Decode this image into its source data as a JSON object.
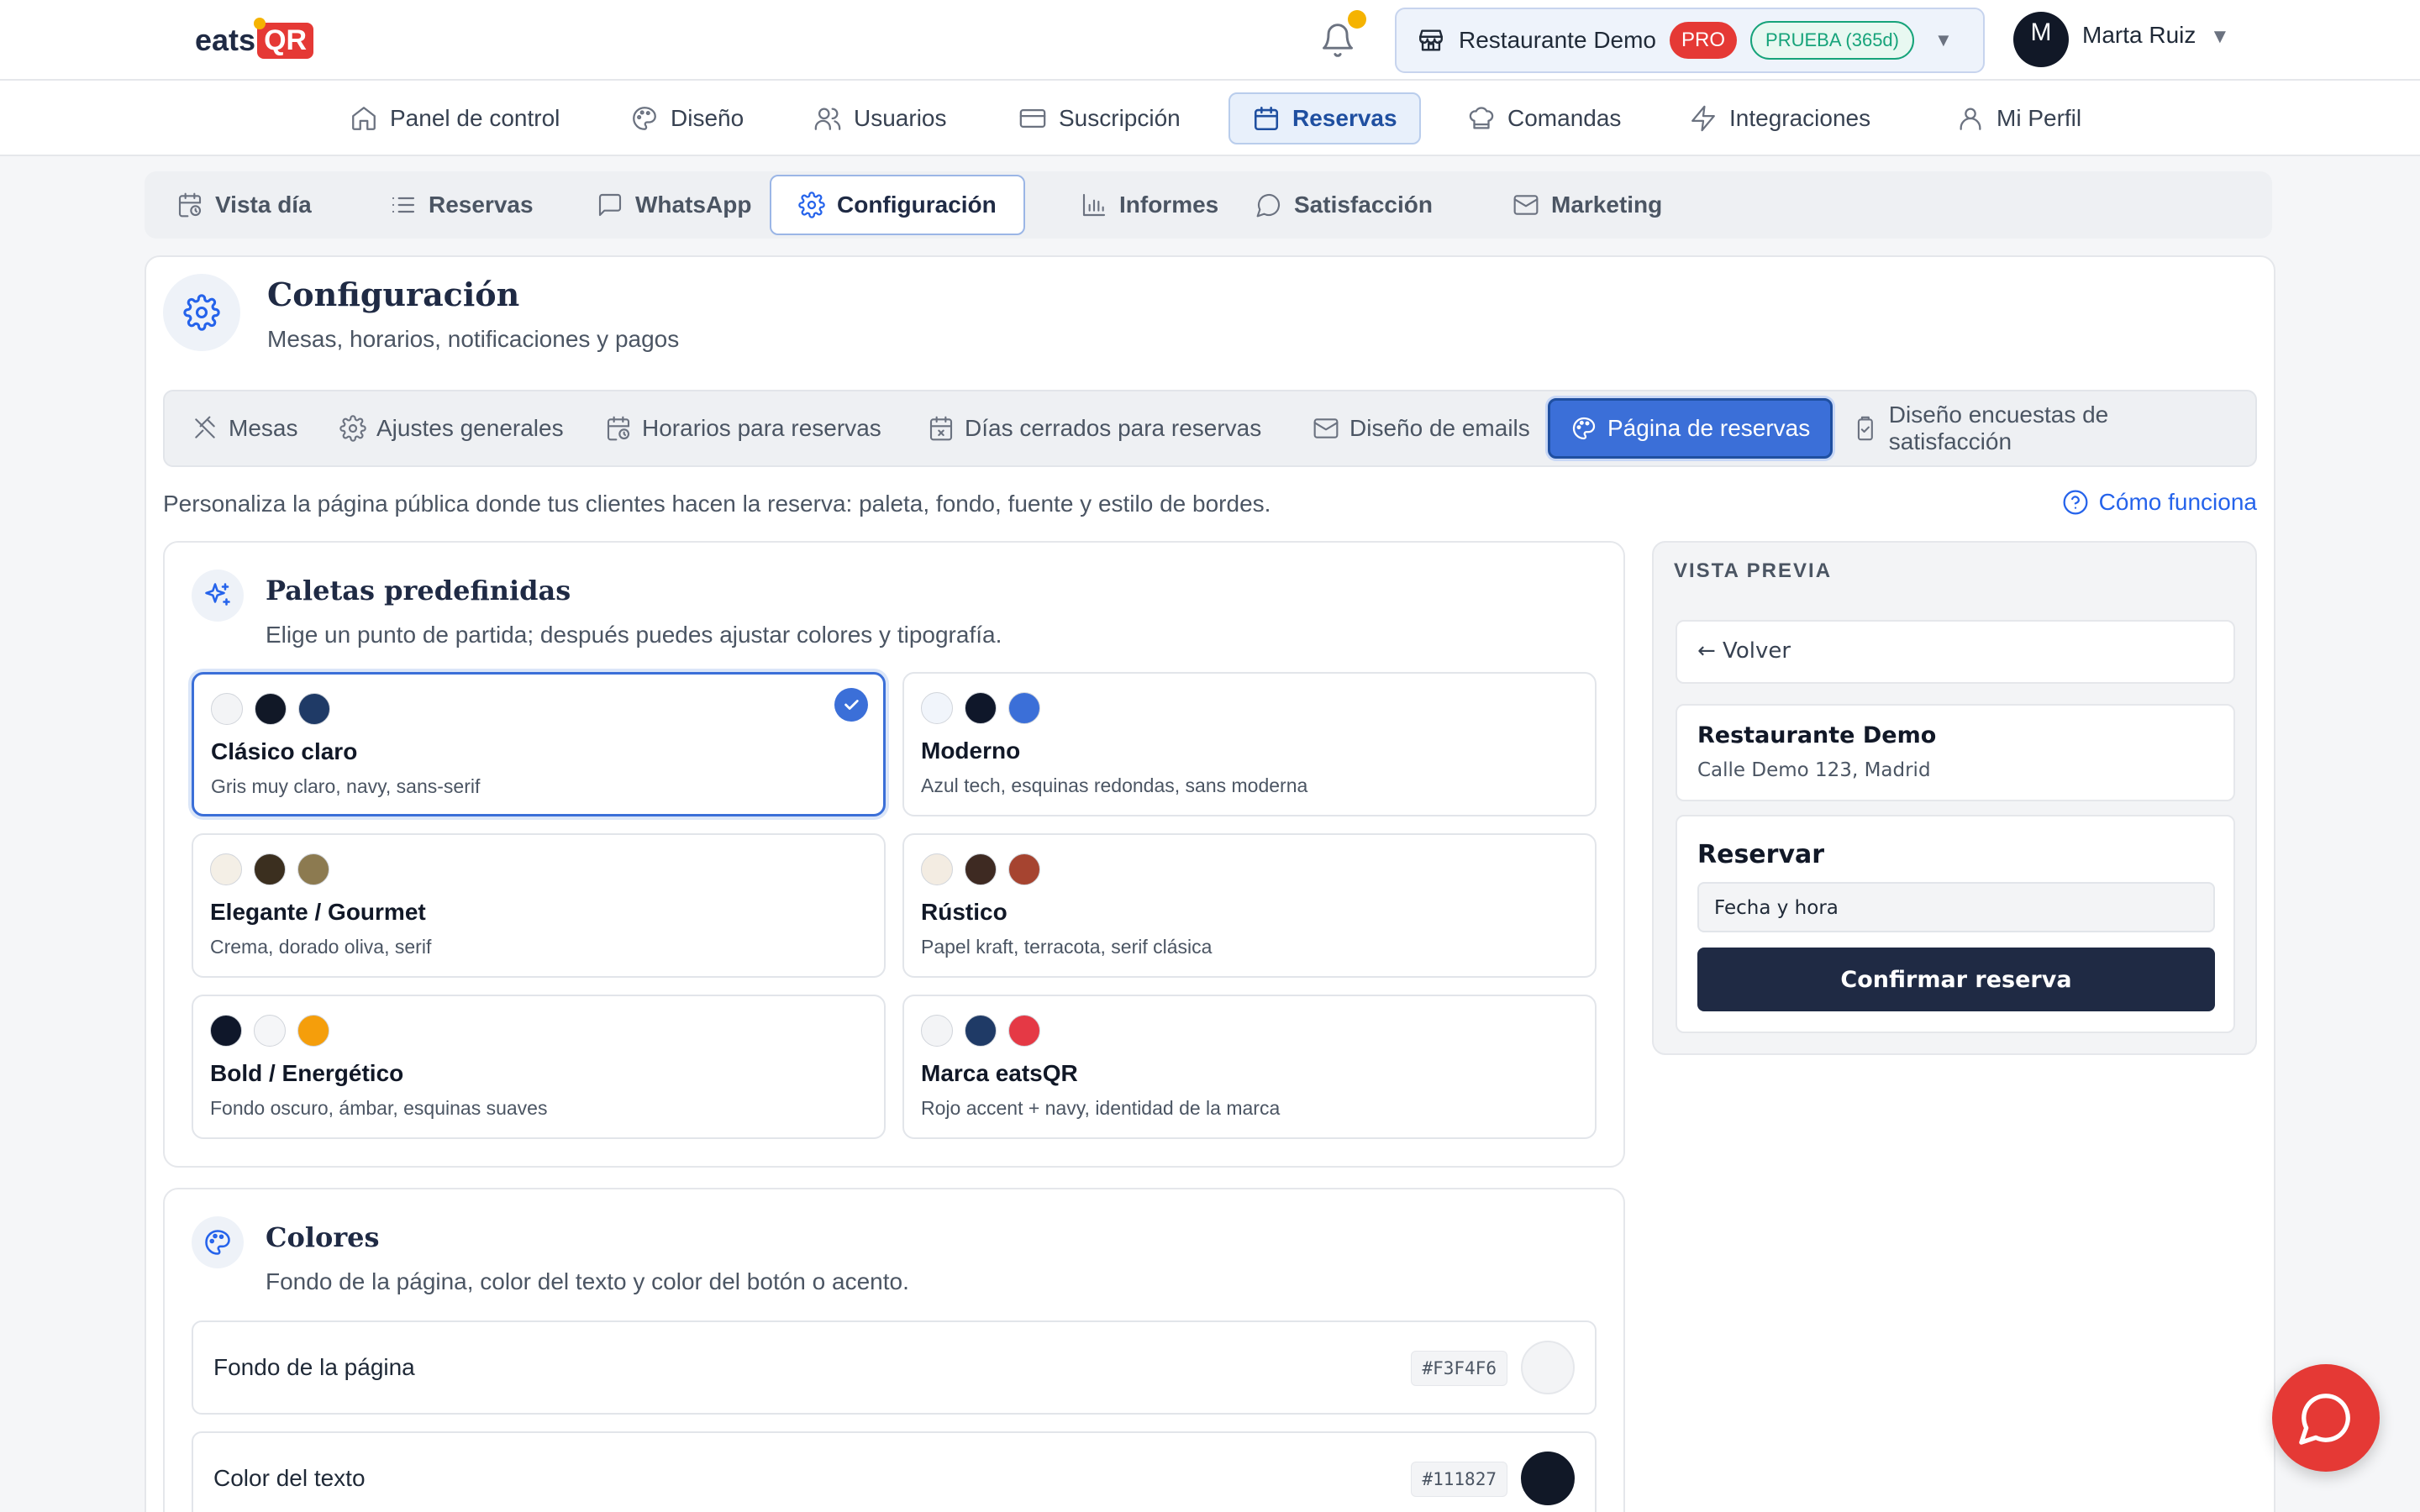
{
  "brand": {
    "logo_text": "eats",
    "logo_badge": "QR"
  },
  "header": {
    "restaurant": "Restaurante Demo",
    "plan_badge": "PRO",
    "trial_badge": "PRUEBA (365d)",
    "user_initial": "M",
    "user_name": "Marta Ruiz"
  },
  "main_nav": [
    {
      "label": "Panel de control",
      "icon": "home-icon"
    },
    {
      "label": "Diseño",
      "icon": "palette-icon"
    },
    {
      "label": "Usuarios",
      "icon": "users-icon"
    },
    {
      "label": "Suscripción",
      "icon": "credit-card-icon"
    },
    {
      "label": "Reservas",
      "icon": "calendar-icon",
      "active": true
    },
    {
      "label": "Comandas",
      "icon": "chef-hat-icon"
    },
    {
      "label": "Integraciones",
      "icon": "bolt-icon"
    },
    {
      "label": "Mi Perfil",
      "icon": "user-icon"
    }
  ],
  "sub_tabs": [
    {
      "label": "Vista día",
      "icon": "calendar-clock-icon"
    },
    {
      "label": "Reservas",
      "icon": "list-icon"
    },
    {
      "label": "WhatsApp",
      "icon": "message-square-icon"
    },
    {
      "label": "Configuración",
      "icon": "gear-icon",
      "active": true
    },
    {
      "label": "Informes",
      "icon": "bar-chart-icon"
    },
    {
      "label": "Satisfacción",
      "icon": "message-circle-icon"
    },
    {
      "label": "Marketing",
      "icon": "mail-icon"
    }
  ],
  "config": {
    "title": "Configuración",
    "subtitle": "Mesas, horarios, notificaciones y pagos",
    "tabs": [
      {
        "label": "Mesas",
        "icon": "utensils-icon"
      },
      {
        "label": "Ajustes generales",
        "icon": "gear-icon"
      },
      {
        "label": "Horarios para reservas",
        "icon": "calendar-clock-icon"
      },
      {
        "label": "Días cerrados para reservas",
        "icon": "calendar-x-icon"
      },
      {
        "label": "Diseño de emails",
        "icon": "mail-icon"
      },
      {
        "label": "Página de reservas",
        "icon": "palette-icon",
        "active": true
      },
      {
        "label": "Diseño encuestas de satisfacción",
        "icon": "clipboard-icon"
      }
    ],
    "description": "Personaliza la página pública donde tus clientes hacen la reserva: paleta, fondo, fuente y estilo de bordes.",
    "how_link": "Cómo funciona"
  },
  "palettes": {
    "title": "Paletas predefinidas",
    "subtitle": "Elige un punto de partida; después puedes ajustar colores y tipografía.",
    "items": [
      {
        "name": "Clásico claro",
        "desc": "Gris muy claro, navy, sans-serif",
        "colors": [
          "#f3f4f6",
          "#111827",
          "#1f3a66"
        ],
        "selected": true
      },
      {
        "name": "Moderno",
        "desc": "Azul tech, esquinas redondas, sans moderna",
        "colors": [
          "#f1f5fb",
          "#0f172a",
          "#3b6fd8"
        ],
        "selected": false
      },
      {
        "name": "Elegante / Gourmet",
        "desc": "Crema, dorado oliva, serif",
        "colors": [
          "#f4efe6",
          "#3b2f1f",
          "#8c7a50"
        ],
        "selected": false
      },
      {
        "name": "Rústico",
        "desc": "Papel kraft, terracota, serif clásica",
        "colors": [
          "#f3ece2",
          "#3e2a22",
          "#a64430"
        ],
        "selected": false
      },
      {
        "name": "Bold / Energético",
        "desc": "Fondo oscuro, ámbar, esquinas suaves",
        "colors": [
          "#0f172a",
          "#f5f6f8",
          "#f59e0b"
        ],
        "selected": false
      },
      {
        "name": "Marca eatsQR",
        "desc": "Rojo accent + navy, identidad de la marca",
        "colors": [
          "#f3f4f6",
          "#1f3a66",
          "#e53945"
        ],
        "selected": false
      }
    ]
  },
  "colors": {
    "title": "Colores",
    "subtitle": "Fondo de la página, color del texto y color del botón o acento.",
    "rows": [
      {
        "label": "Fondo de la página",
        "hex": "#F3F4F6",
        "swatch": "#f3f4f6"
      },
      {
        "label": "Color del texto",
        "hex": "#111827",
        "swatch": "#111827"
      }
    ]
  },
  "preview": {
    "title": "VISTA PREVIA",
    "back": "← Volver",
    "restaurant": "Restaurante Demo",
    "address": "Calle Demo 123, Madrid",
    "reserve_title": "Reservar",
    "input_value": "Fecha y hora",
    "button": "Confirmar reserva"
  }
}
